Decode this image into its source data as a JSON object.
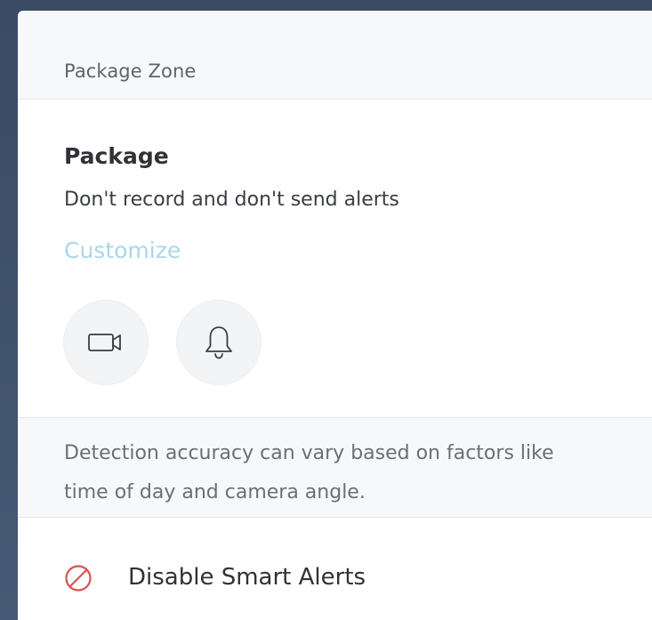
{
  "section": {
    "title": "Package Zone"
  },
  "rule": {
    "title": "Package",
    "description": "Don't record and don't send alerts",
    "customize_label": "Customize",
    "record_icon": "video-camera-icon",
    "alert_icon": "bell-icon"
  },
  "info": {
    "text": "Detection accuracy can vary based on factors like time of day and camera angle."
  },
  "disable": {
    "label": "Disable Smart Alerts",
    "icon": "prohibited-icon"
  },
  "colors": {
    "backdrop": "#3e5068",
    "panel": "#f7f8fa",
    "card": "#ffffff",
    "link": "#a8d7ec",
    "danger": "#d9534f"
  }
}
